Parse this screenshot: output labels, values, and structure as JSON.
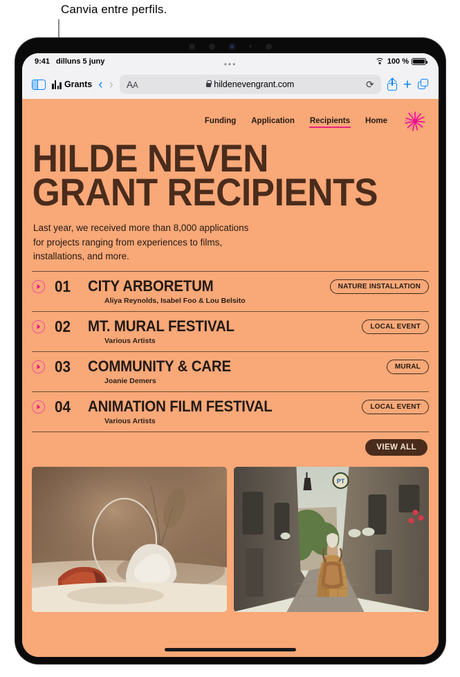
{
  "annotation": {
    "text": "Canvia entre perfils."
  },
  "status_bar": {
    "time": "9:41",
    "date": "dilluns 5 juny",
    "battery_percent": "100 %",
    "wifi_icon": "wifi-icon",
    "battery_icon": "battery-icon"
  },
  "toolbar": {
    "sidebar_icon": "sidebar-icon",
    "profile_name": "Grants",
    "profile_icon": "bar-chart-icon",
    "back_icon": "chevron-left-icon",
    "forward_icon": "chevron-right-icon",
    "page_settings_label": "AA",
    "lock_icon": "lock-icon",
    "url": "hildenevengrant.com",
    "reload_icon": "reload-icon",
    "share_icon": "share-icon",
    "new_tab_icon": "plus-icon",
    "tabs_icon": "tabs-overview-icon",
    "overflow_dots": "•••"
  },
  "site": {
    "nav": [
      {
        "label": "Funding",
        "active": false
      },
      {
        "label": "Application",
        "active": false
      },
      {
        "label": "Recipients",
        "active": true
      },
      {
        "label": "Home",
        "active": false
      }
    ],
    "logo_icon": "starburst-flower-logo",
    "hero_line1": "HILDE NEVEN",
    "hero_line2": "GRANT RECIPIENTS",
    "lede": "Last year, we received more than 8,000 applications for projects ranging from experiences to films, installations, and more.",
    "recipients": [
      {
        "number": "01",
        "title": "CITY ARBORETUM",
        "artists": "Aliya Reynolds, Isabel Foo & Lou Belsito",
        "badge": "NATURE INSTALLATION"
      },
      {
        "number": "02",
        "title": "MT. MURAL FESTIVAL",
        "artists": "Various Artists",
        "badge": "LOCAL EVENT"
      },
      {
        "number": "03",
        "title": "COMMUNITY & CARE",
        "artists": "Joanie Demers",
        "badge": "MURAL"
      },
      {
        "number": "04",
        "title": "ANIMATION FILM FESTIVAL",
        "artists": "Various Artists",
        "badge": "LOCAL EVENT"
      }
    ],
    "view_all_label": "VIEW ALL",
    "photos": [
      {
        "alt": "Sculpture installation with red rock, white plaster and metal ring"
      },
      {
        "alt": "Person with backpack walking through a stone village alley"
      }
    ]
  },
  "colors": {
    "page_background": "#f9a878",
    "ink": "#231a12",
    "accent_pink": "#e8237f",
    "dark_brown": "#4a2c1c",
    "ios_blue": "#0a84ff"
  }
}
